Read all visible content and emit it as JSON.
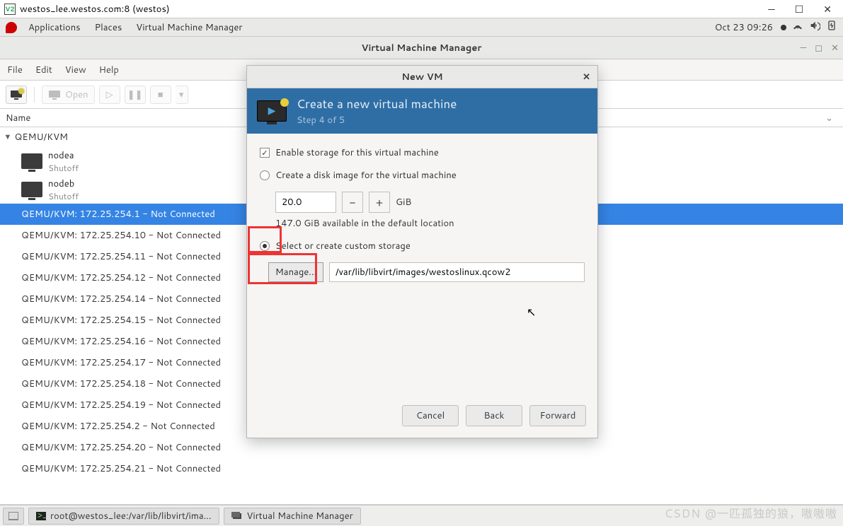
{
  "vncTitle": "westos_lee.westos.com:8 (westos)",
  "gnome": {
    "applications": "Applications",
    "places": "Places",
    "vmm": "Virtual Machine Manager",
    "clock": "Oct 23  09:26"
  },
  "vmmWindow": {
    "title": "Virtual Machine Manager",
    "menus": {
      "file": "File",
      "edit": "Edit",
      "view": "View",
      "help": "Help"
    },
    "toolbar": {
      "open": "Open"
    },
    "listHeader": "Name",
    "hypervisor": "QEMU/KVM",
    "vms": [
      {
        "name": "nodea",
        "status": "Shutoff"
      },
      {
        "name": "nodeb",
        "status": "Shutoff"
      }
    ],
    "connections": [
      "QEMU/KVM: 172.25.254.1 - Not Connected",
      "QEMU/KVM: 172.25.254.10 - Not Connected",
      "QEMU/KVM: 172.25.254.11 - Not Connected",
      "QEMU/KVM: 172.25.254.12 - Not Connected",
      "QEMU/KVM: 172.25.254.14 - Not Connected",
      "QEMU/KVM: 172.25.254.15 - Not Connected",
      "QEMU/KVM: 172.25.254.16 - Not Connected",
      "QEMU/KVM: 172.25.254.17 - Not Connected",
      "QEMU/KVM: 172.25.254.18 - Not Connected",
      "QEMU/KVM: 172.25.254.19 - Not Connected",
      "QEMU/KVM: 172.25.254.2 - Not Connected",
      "QEMU/KVM: 172.25.254.20 - Not Connected",
      "QEMU/KVM: 172.25.254.21 - Not Connected"
    ],
    "selectedConnection": 0
  },
  "dialog": {
    "title": "New VM",
    "heading": "Create a new virtual machine",
    "step": "Step 4 of 5",
    "enableStorage": "Enable storage for this virtual machine",
    "createDisk": "Create a disk image for the virtual machine",
    "sizeValue": "20.0",
    "sizeUnit": "GiB",
    "available": "147.0 GiB available in the default location",
    "customStorage": "Select or create custom storage",
    "manage": "Manage...",
    "path": "/var/lib/libvirt/images/westoslinux.qcow2",
    "cancel": "Cancel",
    "back": "Back",
    "forward": "Forward"
  },
  "taskbar": {
    "terminal": "root@westos_lee:/var/lib/libvirt/ima...",
    "vmm": "Virtual Machine Manager"
  },
  "watermark": "CSDN @一匹孤独的狼，嗷嗷嗷"
}
